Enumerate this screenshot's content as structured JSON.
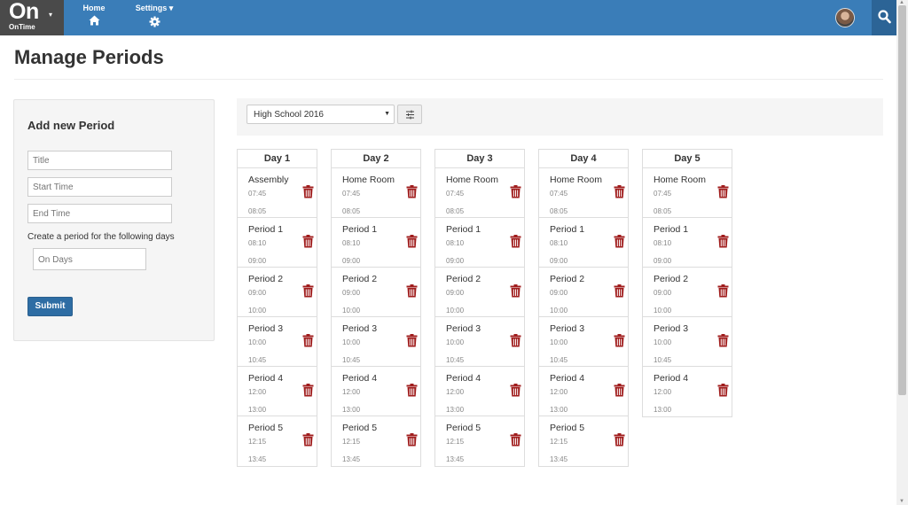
{
  "brand": {
    "name": "On",
    "caret": "▾",
    "sub": "OnTime"
  },
  "nav": {
    "home_label": "Home",
    "settings_label": "Settings ▾"
  },
  "page": {
    "title": "Manage Periods"
  },
  "form": {
    "heading": "Add new Period",
    "title_placeholder": "Title",
    "start_placeholder": "Start Time",
    "end_placeholder": "End Time",
    "days_label": "Create a period for the following days",
    "days_placeholder": "On Days",
    "submit_label": "Submit"
  },
  "filter": {
    "school_value": "High School 2016"
  },
  "colors": {
    "nav": "#3a7db8",
    "brand_bg": "#4a4a4a",
    "search_bg": "#2c6496",
    "trash": "#a01d1d",
    "submit": "#2e6da4"
  },
  "days": [
    {
      "label": "Day 1",
      "periods": [
        {
          "name": "Assembly",
          "start": "07:45",
          "end": "08:05"
        },
        {
          "name": "Period 1",
          "start": "08:10",
          "end": "09:00"
        },
        {
          "name": "Period 2",
          "start": "09:00",
          "end": "10:00"
        },
        {
          "name": "Period 3",
          "start": "10:00",
          "end": "10:45"
        },
        {
          "name": "Period 4",
          "start": "12:00",
          "end": "13:00"
        },
        {
          "name": "Period 5",
          "start": "12:15",
          "end": "13:45"
        }
      ]
    },
    {
      "label": "Day 2",
      "periods": [
        {
          "name": "Home Room",
          "start": "07:45",
          "end": "08:05"
        },
        {
          "name": "Period 1",
          "start": "08:10",
          "end": "09:00"
        },
        {
          "name": "Period 2",
          "start": "09:00",
          "end": "10:00"
        },
        {
          "name": "Period 3",
          "start": "10:00",
          "end": "10:45"
        },
        {
          "name": "Period 4",
          "start": "12:00",
          "end": "13:00"
        },
        {
          "name": "Period 5",
          "start": "12:15",
          "end": "13:45"
        }
      ]
    },
    {
      "label": "Day 3",
      "periods": [
        {
          "name": "Home Room",
          "start": "07:45",
          "end": "08:05"
        },
        {
          "name": "Period 1",
          "start": "08:10",
          "end": "09:00"
        },
        {
          "name": "Period 2",
          "start": "09:00",
          "end": "10:00"
        },
        {
          "name": "Period 3",
          "start": "10:00",
          "end": "10:45"
        },
        {
          "name": "Period 4",
          "start": "12:00",
          "end": "13:00"
        },
        {
          "name": "Period 5",
          "start": "12:15",
          "end": "13:45"
        }
      ]
    },
    {
      "label": "Day 4",
      "periods": [
        {
          "name": "Home Room",
          "start": "07:45",
          "end": "08:05"
        },
        {
          "name": "Period 1",
          "start": "08:10",
          "end": "09:00"
        },
        {
          "name": "Period 2",
          "start": "09:00",
          "end": "10:00"
        },
        {
          "name": "Period 3",
          "start": "10:00",
          "end": "10:45"
        },
        {
          "name": "Period 4",
          "start": "12:00",
          "end": "13:00"
        },
        {
          "name": "Period 5",
          "start": "12:15",
          "end": "13:45"
        }
      ]
    },
    {
      "label": "Day 5",
      "periods": [
        {
          "name": "Home Room",
          "start": "07:45",
          "end": "08:05"
        },
        {
          "name": "Period 1",
          "start": "08:10",
          "end": "09:00"
        },
        {
          "name": "Period 2",
          "start": "09:00",
          "end": "10:00"
        },
        {
          "name": "Period 3",
          "start": "10:00",
          "end": "10:45"
        },
        {
          "name": "Period 4",
          "start": "12:00",
          "end": "13:00"
        }
      ]
    }
  ]
}
